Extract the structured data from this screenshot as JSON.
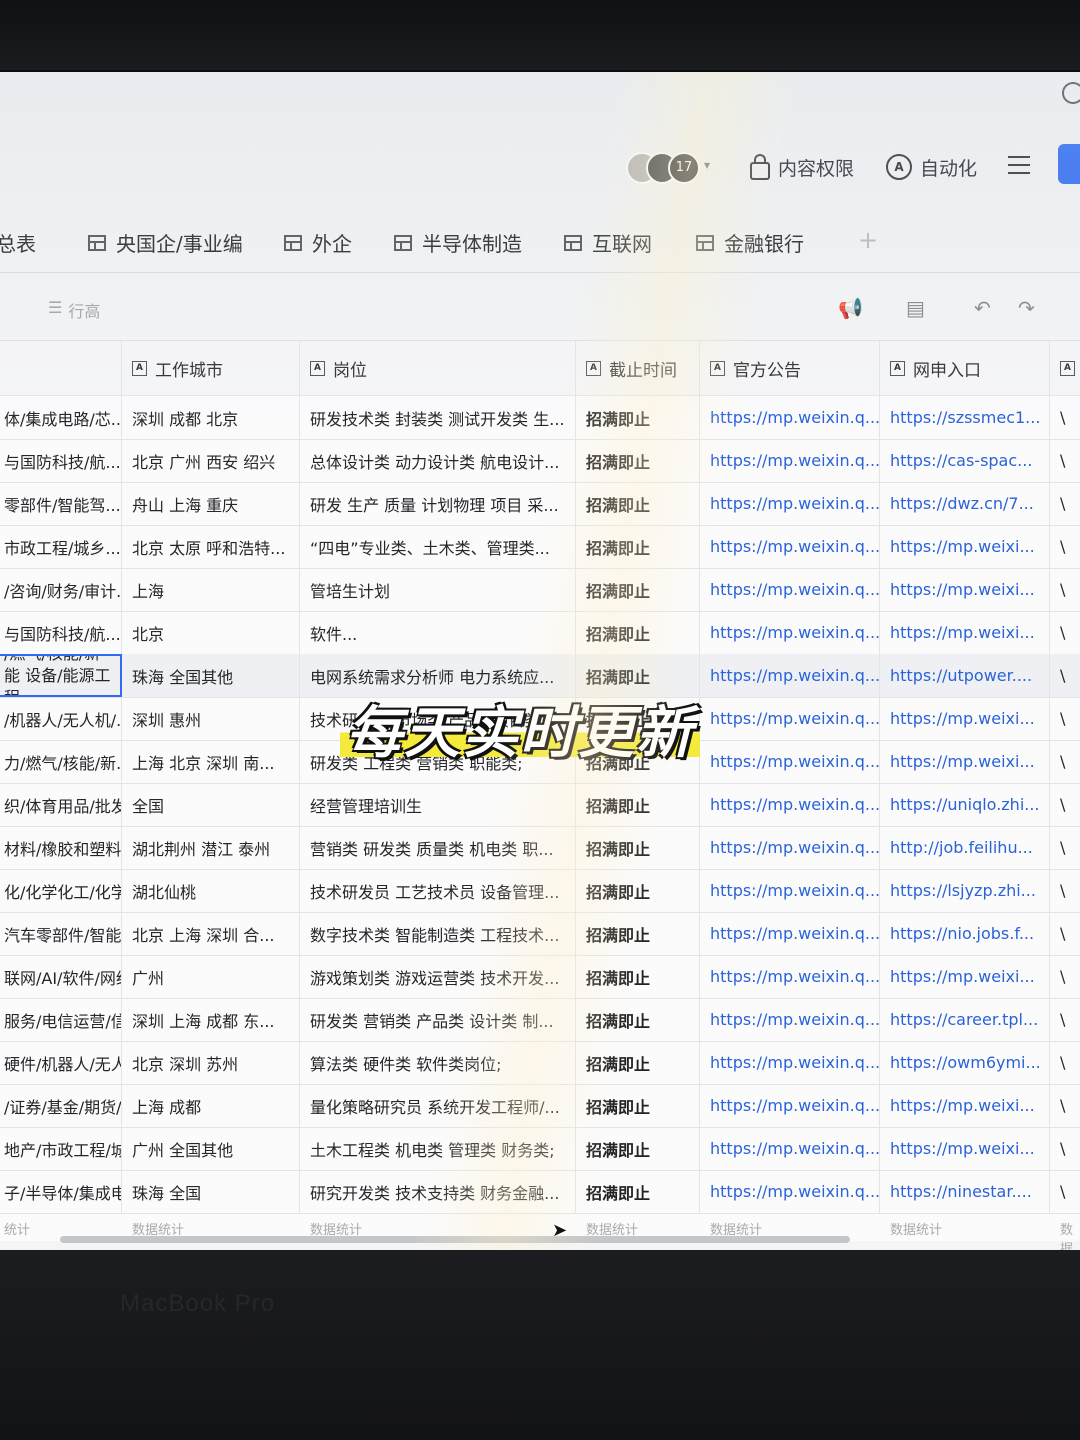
{
  "topbar": {
    "collaborator_count": "17",
    "content_permission_label": "内容权限",
    "automation_label": "自动化"
  },
  "tabs": [
    {
      "label": "总表"
    },
    {
      "label": "央国企/事业编"
    },
    {
      "label": "外企"
    },
    {
      "label": "半导体制造"
    },
    {
      "label": "互联网"
    },
    {
      "label": "金融银行"
    }
  ],
  "toolbar": {
    "row_height_label": "行高"
  },
  "table": {
    "headers": [
      "工作城市",
      "岗位",
      "截止时间",
      "官方公告",
      "网申入口"
    ],
    "rows": [
      {
        "industry": "体/集成电路/芯...",
        "city": "深圳 成都 北京",
        "position": "研发技术类 封装类 测试开发类 生...",
        "deadline": "招满即止",
        "notice": "https://mp.weixin.q...",
        "apply": "https://szssmec1..."
      },
      {
        "industry": "与国防科技/航...",
        "city": "北京 广州 西安 绍兴",
        "position": "总体设计类 动力设计类 航电设计...",
        "deadline": "招满即止",
        "notice": "https://mp.weixin.q...",
        "apply": "https://cas-spac..."
      },
      {
        "industry": "零部件/智能驾...",
        "city": "舟山 上海 重庆",
        "position": "研发 生产 质量 计划物理 项目 采...",
        "deadline": "招满即止",
        "notice": "https://mp.weixin.q...",
        "apply": "https://dwz.cn/7..."
      },
      {
        "industry": "市政工程/城乡...",
        "city": "北京 太原 呼和浩特...",
        "position": "“四电”专业类、土木类、管理类...",
        "deadline": "招满即止",
        "notice": "https://mp.weixin.q...",
        "apply": "https://mp.weixi..."
      },
      {
        "industry": "/咨询/财务/审计...",
        "city": "上海",
        "position": "管培生计划",
        "deadline": "招满即止",
        "notice": "https://mp.weixin.q...",
        "apply": "https://mp.weixi..."
      },
      {
        "industry": "与国防科技/航...",
        "city": "北京",
        "position": "软件...",
        "deadline": "招满即止",
        "notice": "https://mp.weixin.q...",
        "apply": "https://mp.weixi..."
      },
      {
        "industry": "/燃气/核能/新能 设备/能源工程",
        "city": "珠海 全国其他",
        "position": "电网系统需求分析师 电力系统应...",
        "deadline": "招满即止",
        "notice": "https://mp.weixin.q...",
        "apply": "https://utpower...."
      },
      {
        "industry": "/机器人/无人机/...",
        "city": "深圳 惠州",
        "position": "技术研发类 市场类 产品&项目类 ...",
        "deadline": "招满即止",
        "notice": "https://mp.weixin.q...",
        "apply": "https://mp.weixi..."
      },
      {
        "industry": "力/燃气/核能/新...",
        "city": "上海 北京 深圳 南...",
        "position": "研发类 工程类 营销类 职能类;",
        "deadline": "招满即止",
        "notice": "https://mp.weixin.q...",
        "apply": "https://mp.weixi..."
      },
      {
        "industry": "织/体育用品/批发...",
        "city": "全国",
        "position": "经营管理培训生",
        "deadline": "招满即止",
        "notice": "https://mp.weixin.q...",
        "apply": "https://uniqlo.zhi..."
      },
      {
        "industry": "材料/橡胶和塑料...",
        "city": "湖北荆州 潜江 泰州",
        "position": "营销类 研发类 质量类 机电类 职...",
        "deadline": "招满即止",
        "notice": "https://mp.weixin.q...",
        "apply": "http://job.feilihu..."
      },
      {
        "industry": "化/化学化工/化学...",
        "city": "湖北仙桃",
        "position": "技术研发员 工艺技术员 设备管理...",
        "deadline": "招满即止",
        "notice": "https://mp.weixin.q...",
        "apply": "https://lsjyzp.zhi..."
      },
      {
        "industry": "汽车零部件/智能驾...",
        "city": "北京 上海 深圳 合...",
        "position": "数字技术类 智能制造类 工程技术...",
        "deadline": "招满即止",
        "notice": "https://mp.weixin.q...",
        "apply": "https://nio.jobs.f..."
      },
      {
        "industry": "联网/AI/软件/网络安...",
        "city": "广州",
        "position": "游戏策划类 游戏运营类 技术开发...",
        "deadline": "招满即止",
        "notice": "https://mp.weixin.q...",
        "apply": "https://mp.weixi..."
      },
      {
        "industry": "服务/电信运营/信息...",
        "city": "深圳 上海 成都 东...",
        "position": "研发类 营销类 产品类 设计类 制...",
        "deadline": "招满即止",
        "notice": "https://mp.weixin.q...",
        "apply": "https://career.tpl..."
      },
      {
        "industry": "硬件/机器人/无人机/...",
        "city": "北京 深圳 苏州",
        "position": "算法类 硬件类 软件类岗位;",
        "deadline": "招满即止",
        "notice": "https://mp.weixin.q...",
        "apply": "https://owm6ymi..."
      },
      {
        "industry": "/证券/基金/期货/保...",
        "city": "上海 成都",
        "position": "量化策略研究员 系统开发工程师/...",
        "deadline": "招满即止",
        "notice": "https://mp.weixin.q...",
        "apply": "https://mp.weixi..."
      },
      {
        "industry": "地产/市政工程/城乡...",
        "city": "广州 全国其他",
        "position": "土木工程类 机电类 管理类 财务类;",
        "deadline": "招满即止",
        "notice": "https://mp.weixin.q...",
        "apply": "https://mp.weixi..."
      },
      {
        "industry": "子/半导体/集成电路/芯...",
        "city": "珠海 全国",
        "position": "研究开发类 技术支持类 财务金融...",
        "deadline": "招满即止",
        "notice": "https://mp.weixin.q...",
        "apply": "https://ninestar...."
      }
    ],
    "footer": [
      "统计",
      "数据统计",
      "数据统计",
      "数据统计",
      "数据统计",
      "数据统计",
      "数据统计"
    ]
  },
  "overlay": {
    "caption": "每天实时更新"
  },
  "bezel": {
    "label": "MacBook Pro"
  },
  "colors": {
    "accent": "#2f6cf5",
    "link": "#2a62d9",
    "caption_highlight": "#f3ea3c"
  }
}
